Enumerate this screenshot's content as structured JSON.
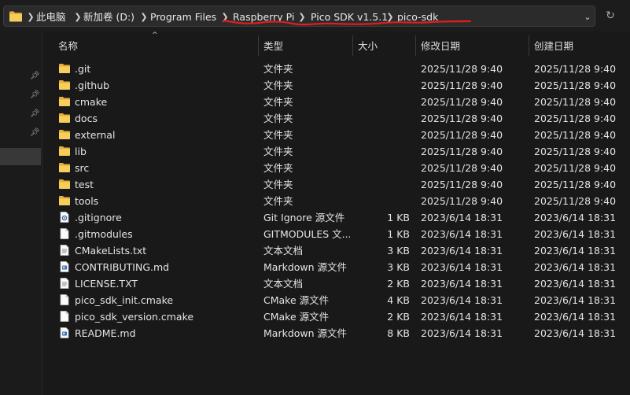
{
  "address_bar": {
    "crumbs": [
      "此电脑",
      "新加卷 (D:)",
      "Program Files",
      "Raspberry Pi",
      "Pico SDK v1.5.1",
      "pico-sdk"
    ],
    "highlight_color": "#e01e1e"
  },
  "columns": {
    "name": "名称",
    "type": "类型",
    "size": "大小",
    "modified": "修改日期",
    "created": "创建日期"
  },
  "files": [
    {
      "name": ".git",
      "icon": "folder-icon",
      "type": "文件夹",
      "size": "",
      "modified": "2025/11/28 9:40",
      "created": "2025/11/28 9:40"
    },
    {
      "name": ".github",
      "icon": "folder-icon",
      "type": "文件夹",
      "size": "",
      "modified": "2025/11/28 9:40",
      "created": "2025/11/28 9:40"
    },
    {
      "name": "cmake",
      "icon": "folder-icon",
      "type": "文件夹",
      "size": "",
      "modified": "2025/11/28 9:40",
      "created": "2025/11/28 9:40"
    },
    {
      "name": "docs",
      "icon": "folder-icon",
      "type": "文件夹",
      "size": "",
      "modified": "2025/11/28 9:40",
      "created": "2025/11/28 9:40"
    },
    {
      "name": "external",
      "icon": "folder-icon",
      "type": "文件夹",
      "size": "",
      "modified": "2025/11/28 9:40",
      "created": "2025/11/28 9:40"
    },
    {
      "name": "lib",
      "icon": "folder-icon",
      "type": "文件夹",
      "size": "",
      "modified": "2025/11/28 9:40",
      "created": "2025/11/28 9:40"
    },
    {
      "name": "src",
      "icon": "folder-icon",
      "type": "文件夹",
      "size": "",
      "modified": "2025/11/28 9:40",
      "created": "2025/11/28 9:40"
    },
    {
      "name": "test",
      "icon": "folder-icon",
      "type": "文件夹",
      "size": "",
      "modified": "2025/11/28 9:40",
      "created": "2025/11/28 9:40"
    },
    {
      "name": "tools",
      "icon": "folder-icon",
      "type": "文件夹",
      "size": "",
      "modified": "2025/11/28 9:40",
      "created": "2025/11/28 9:40"
    },
    {
      "name": ".gitignore",
      "icon": "settings-file-icon",
      "type": "Git Ignore 源文件",
      "size": "1 KB",
      "modified": "2023/6/14 18:31",
      "created": "2023/6/14 18:31"
    },
    {
      "name": ".gitmodules",
      "icon": "file-icon",
      "type": "GITMODULES 文...",
      "size": "1 KB",
      "modified": "2023/6/14 18:31",
      "created": "2023/6/14 18:31"
    },
    {
      "name": "CMakeLists.txt",
      "icon": "text-file-icon",
      "type": "文本文档",
      "size": "3 KB",
      "modified": "2023/6/14 18:31",
      "created": "2023/6/14 18:31"
    },
    {
      "name": "CONTRIBUTING.md",
      "icon": "markdown-file-icon",
      "type": "Markdown 源文件",
      "size": "3 KB",
      "modified": "2023/6/14 18:31",
      "created": "2023/6/14 18:31"
    },
    {
      "name": "LICENSE.TXT",
      "icon": "text-file-icon",
      "type": "文本文档",
      "size": "2 KB",
      "modified": "2023/6/14 18:31",
      "created": "2023/6/14 18:31"
    },
    {
      "name": "pico_sdk_init.cmake",
      "icon": "file-icon",
      "type": "CMake 源文件",
      "size": "4 KB",
      "modified": "2023/6/14 18:31",
      "created": "2023/6/14 18:31"
    },
    {
      "name": "pico_sdk_version.cmake",
      "icon": "file-icon",
      "type": "CMake 源文件",
      "size": "2 KB",
      "modified": "2023/6/14 18:31",
      "created": "2023/6/14 18:31"
    },
    {
      "name": "README.md",
      "icon": "markdown-file-icon",
      "type": "Markdown 源文件",
      "size": "8 KB",
      "modified": "2023/6/14 18:31",
      "created": "2023/6/14 18:31"
    }
  ]
}
